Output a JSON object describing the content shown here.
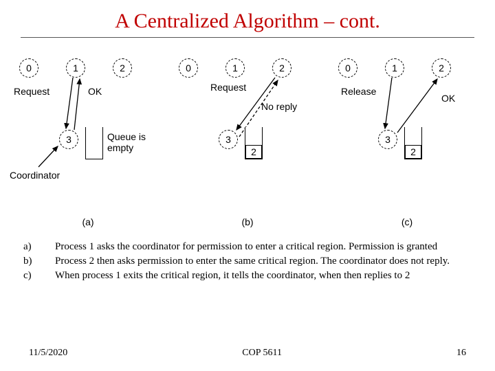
{
  "title": "A Centralized Algorithm – cont.",
  "panels": {
    "a": {
      "nodes": {
        "n0": "0",
        "n1": "1",
        "n2": "2",
        "n3": "3"
      },
      "labels": {
        "request": "Request",
        "ok": "OK",
        "coord": "Coordinator",
        "queue": "Queue is\nempty"
      },
      "caption": "(a)"
    },
    "b": {
      "nodes": {
        "n0": "0",
        "n1": "1",
        "n2": "2",
        "n3": "3"
      },
      "labels": {
        "request": "Request",
        "noreply": "No reply"
      },
      "queue_item": "2",
      "caption": "(b)"
    },
    "c": {
      "nodes": {
        "n0": "0",
        "n1": "1",
        "n2": "2",
        "n3": "3"
      },
      "labels": {
        "release": "Release",
        "ok": "OK"
      },
      "queue_item": "2",
      "caption": "(c)"
    }
  },
  "descriptions": [
    {
      "key": "a)",
      "text": "Process 1 asks the coordinator for permission to enter a critical region.  Permission is granted"
    },
    {
      "key": "b)",
      "text": "Process 2 then asks permission to enter the same critical region.  The coordinator does not reply."
    },
    {
      "key": "c)",
      "text": "When process 1 exits the critical region, it tells the coordinator, when then replies to 2"
    }
  ],
  "footer": {
    "date": "11/5/2020",
    "course": "COP 5611",
    "page": "16"
  }
}
